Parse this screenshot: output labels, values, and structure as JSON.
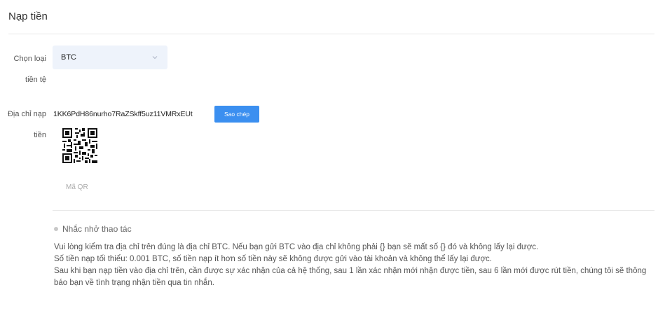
{
  "header": {
    "title": "Nạp tiền"
  },
  "form": {
    "currency_label": "Chọn loại tiền tệ",
    "currency_selected": "BTC",
    "address_label": "Địa chỉ nạp tiền",
    "address_value": "1KK6PdH86nurho7RaZSkff5uz11VMRxEUt",
    "copy_button": "Sao chép",
    "qr_label": "Mã QR"
  },
  "notice": {
    "title": "Nhắc nhở thao tác",
    "lines": [
      "Vui lòng kiểm tra địa chỉ trên đúng là địa chỉ BTC. Nếu bạn gửi BTC vào địa chỉ không phải {} bạn sẽ mất số {} đó và không lấy lại được.",
      "Số tiền nạp tối thiểu: 0.001 BTC, số tiền nạp ít hơn số tiền này sẽ không được gửi vào tài khoản và không thể lấy lại được.",
      "Sau khi bạn nạp tiền vào địa chỉ trên, cần được sự xác nhận của cả hệ thống, sau 1 lần xác nhận mới nhận được tiền, sau 6 lần mới được rút tiền, chúng tôi sẽ thông báo bạn về tình trạng nhận tiền qua tin nhắn."
    ]
  },
  "icons": {
    "select_chevron": "chevron-down-icon",
    "qr": "qr-code-icon",
    "bullet": "bullet-icon"
  },
  "colors": {
    "accent": "#3b8ff0",
    "select_bg": "#eef3fb"
  }
}
